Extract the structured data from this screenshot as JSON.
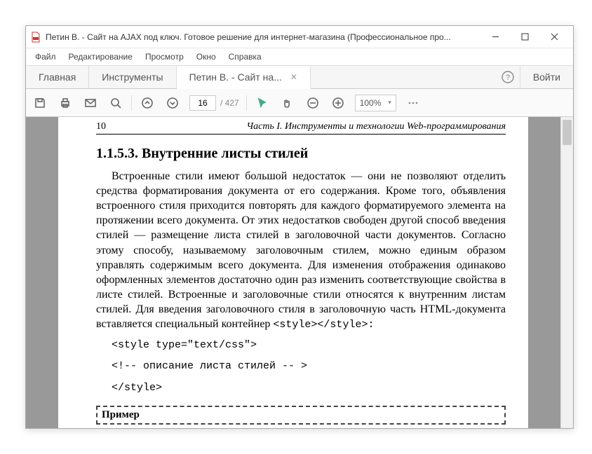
{
  "window": {
    "title": "Петин В. - Сайт на AJAX под ключ. Готовое решение для интернет-магазина (Профессиональное про..."
  },
  "menu": {
    "file": "Файл",
    "edit": "Редактирование",
    "view": "Просмотр",
    "window": "Окно",
    "help": "Справка"
  },
  "tabs": {
    "home": "Главная",
    "tools": "Инструменты",
    "doc": "Петин В. - Сайт на..."
  },
  "login": "Войти",
  "toolbar": {
    "page_current": "16",
    "page_total": "/  427",
    "zoom": "100%"
  },
  "doc": {
    "page_num": "10",
    "part_title": "Часть I. Инструменты и технологии Web-программирования",
    "section": "1.1.5.3. Внутренние листы стилей",
    "paragraph": "Встроенные стили имеют большой недостаток — они не позволяют отделить средства форматирования документа от его содержания. Кроме того, объявления встроенного стиля приходится повторять для каждого форматируемого элемента на протяжении всего документа. От этих недостатков свободен другой способ введения стилей — размещение листа стилей в заголовочной части документов. Согласно этому способу, называемому заголовочным стилем, можно единым образом управлять содержимым всего документа. Для изменения отображения одинаково оформленных элементов достаточно один раз изменить соответствующие свойства в листе стилей. Встроенные и заголовочные стили относятся к внутренним листам стилей. Для введения заголовочного стиля в заголовочную часть HTML-документа вставляется специальный контейнер ",
    "inline_code": "<style></style>:",
    "code1": "<style type=\"text/css\">",
    "code2": "<!--  описание листа стилей  -- >",
    "code3": "</style>",
    "example_label": "Пример"
  }
}
